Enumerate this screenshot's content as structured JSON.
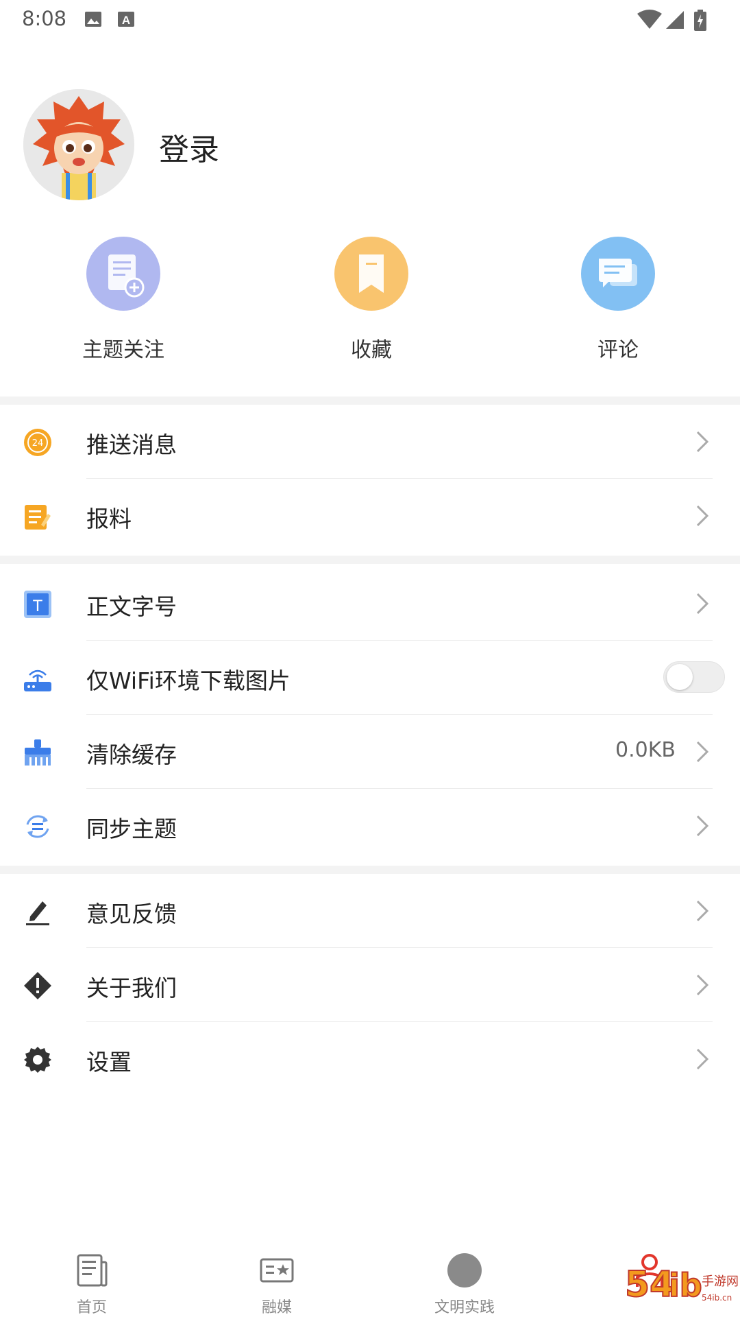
{
  "status_bar": {
    "time": "8:08",
    "icons": [
      "image-icon",
      "keyboard-a-icon",
      "wifi-icon",
      "signal-icon",
      "battery-charging-icon"
    ]
  },
  "profile": {
    "login_label": "登录",
    "avatar_icon": "cartoon-lion-avatar"
  },
  "quick_actions": [
    {
      "label": "主题关注",
      "icon": "document-add-icon",
      "color": "#a9b3ee"
    },
    {
      "label": "收藏",
      "icon": "bookmark-icon",
      "color": "#f9c46e"
    },
    {
      "label": "评论",
      "icon": "comment-icon",
      "color": "#82c0f3"
    }
  ],
  "menu": {
    "group1": [
      {
        "label": "推送消息",
        "icon": "clock-24-icon"
      },
      {
        "label": "报料",
        "icon": "notepad-edit-icon"
      }
    ],
    "group2": [
      {
        "label": "正文字号",
        "icon": "text-size-icon"
      },
      {
        "label": "仅WiFi环境下载图片",
        "icon": "router-icon",
        "toggle_on": false
      },
      {
        "label": "清除缓存",
        "icon": "broom-icon",
        "value": "0.0KB"
      },
      {
        "label": "同步主题",
        "icon": "sync-icon"
      }
    ],
    "group3": [
      {
        "label": "意见反馈",
        "icon": "pencil-icon"
      },
      {
        "label": "关于我们",
        "icon": "info-diamond-icon"
      },
      {
        "label": "设置",
        "icon": "gear-icon"
      }
    ]
  },
  "tab_bar": {
    "items": [
      {
        "label": "首页",
        "icon": "newspaper-icon"
      },
      {
        "label": "融媒",
        "icon": "media-card-icon"
      },
      {
        "label": "文明实践",
        "icon": "circle-icon"
      },
      {
        "label": "",
        "icon": "person-icon",
        "active": true
      }
    ],
    "active_color": "#e2362c"
  },
  "watermark": {
    "text": "54ib手游网",
    "sub": "www.54ib.cn"
  },
  "colors": {
    "accent_red": "#e2362c",
    "orange": "#f6a623",
    "blue": "#3b7de9",
    "divider": "#f3f3f3"
  }
}
